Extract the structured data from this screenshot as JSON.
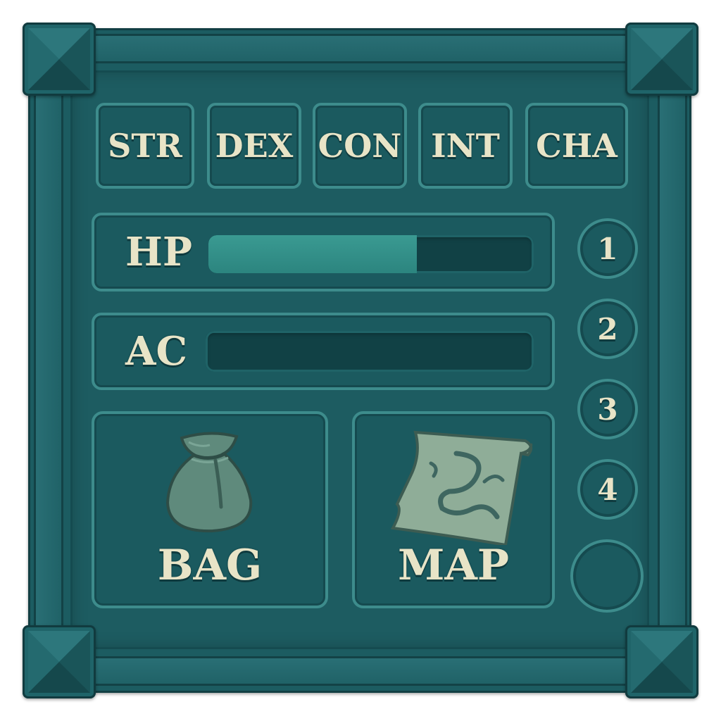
{
  "stats": [
    {
      "label": "STR"
    },
    {
      "label": "DEX"
    },
    {
      "label": "CON"
    },
    {
      "label": "INT"
    },
    {
      "label": "CHA"
    }
  ],
  "bars": {
    "hp": {
      "label": "HP",
      "fill_fraction": 0.64
    },
    "ac": {
      "label": "AC",
      "fill_fraction": 0.0
    }
  },
  "buttons": {
    "bag": {
      "label": "BAG",
      "icon": "bag-icon"
    },
    "map": {
      "label": "MAP",
      "icon": "map-icon"
    }
  },
  "slots": [
    {
      "label": "1"
    },
    {
      "label": "2"
    },
    {
      "label": "3"
    },
    {
      "label": "4"
    },
    {
      "label": ""
    }
  ],
  "colors": {
    "panel": "#1d5c61",
    "border": "#3d8c8c",
    "text": "#e8e4c7",
    "hp_fill": "#3a9a92"
  }
}
